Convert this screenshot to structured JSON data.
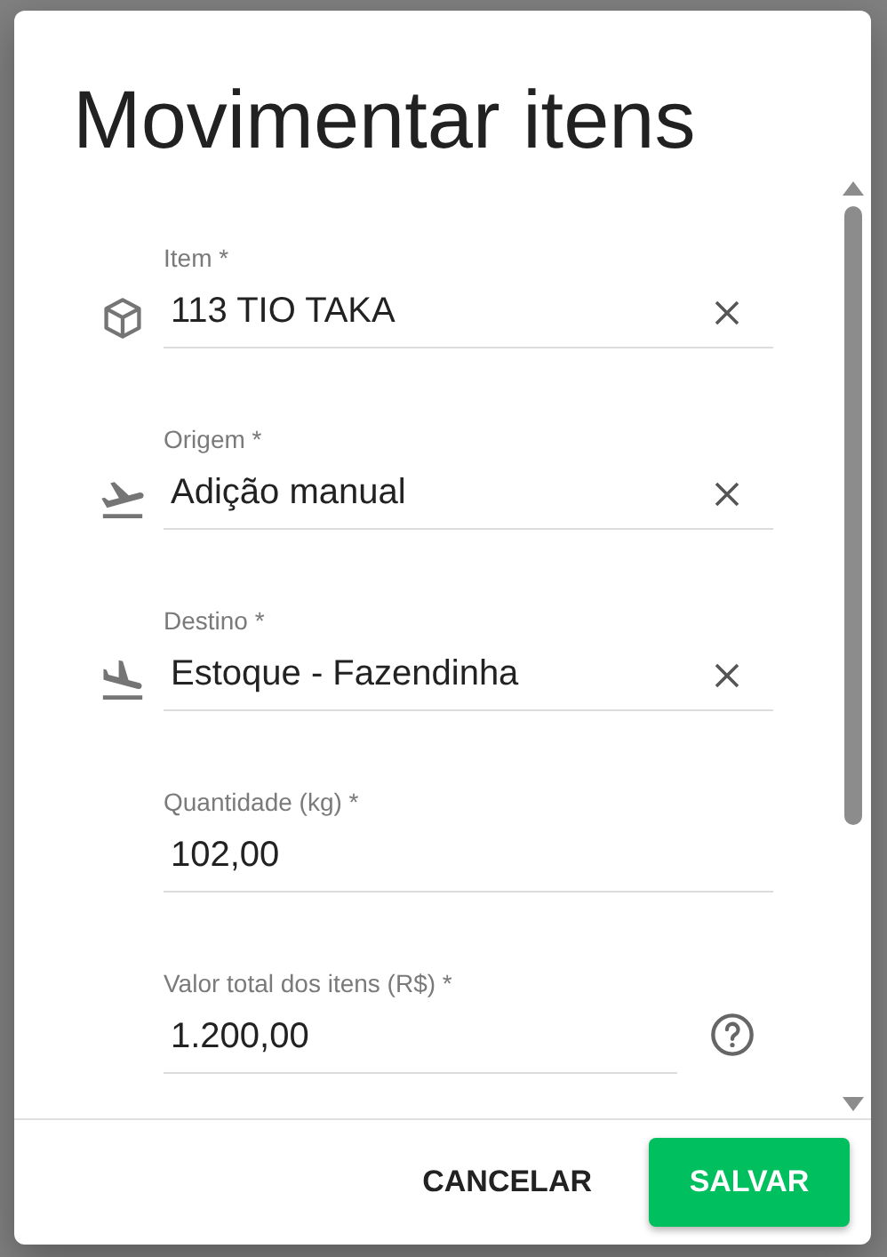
{
  "dialog": {
    "title": "Movimentar itens",
    "fields": [
      {
        "label": "Item *",
        "value": "113 TIO TAKA",
        "kind": "product"
      },
      {
        "label": "Origem *",
        "value": "Adição manual",
        "kind": "source"
      },
      {
        "label": "Destino *",
        "value": "Estoque - Fazendinha",
        "kind": "destination"
      },
      {
        "label": "Quantidade (kg) *",
        "value": "102,00",
        "kind": "quantity"
      },
      {
        "label": "Valor total dos itens (R$) *",
        "value": "1.200,00",
        "kind": "money"
      }
    ],
    "buttons": [
      {
        "label": "CANCELAR",
        "kind": "text"
      },
      {
        "label": "SALVAR",
        "kind": "primary"
      }
    ]
  }
}
